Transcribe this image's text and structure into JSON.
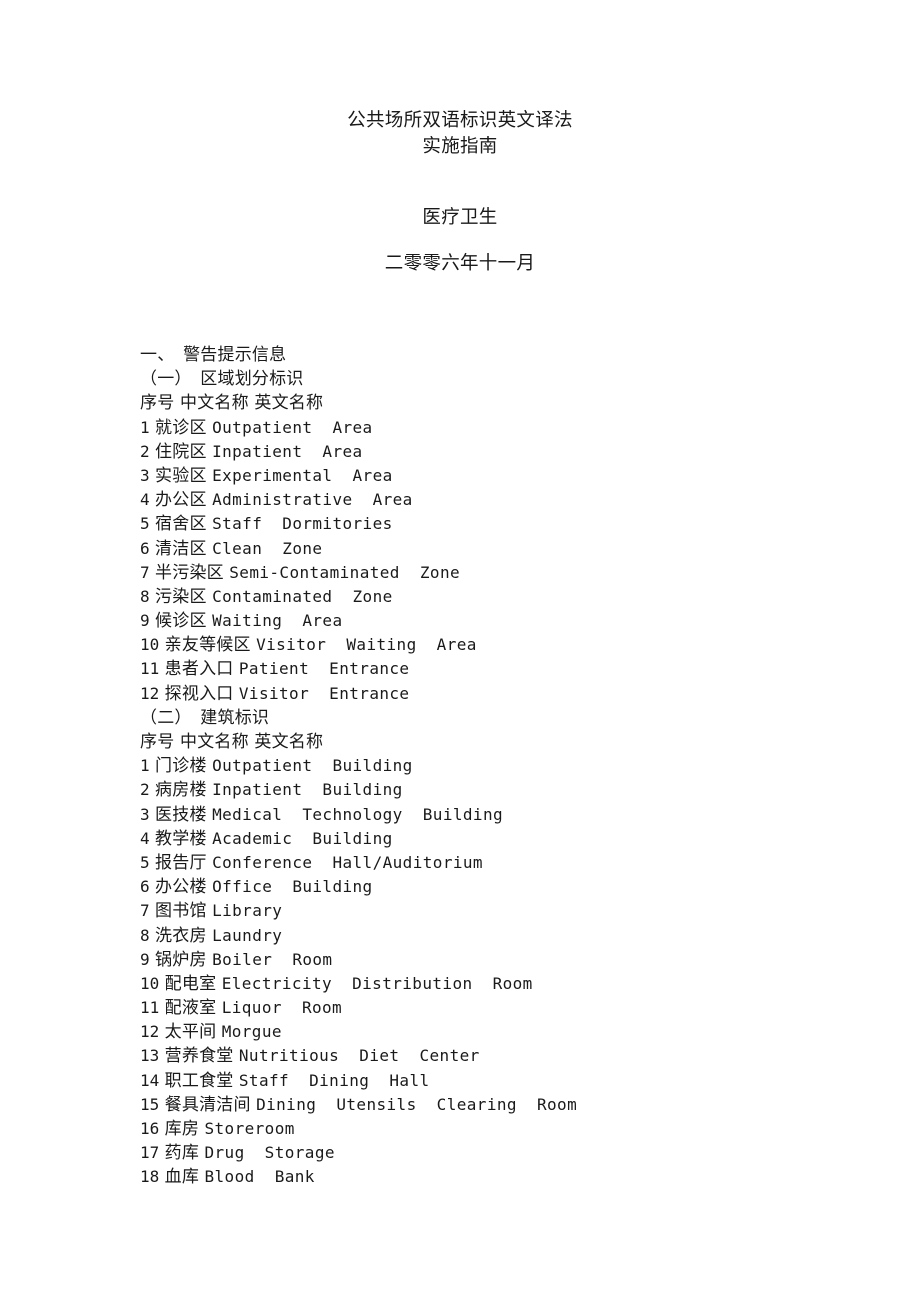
{
  "document": {
    "title_lines": [
      "公共场所双语标识英文译法",
      "实施指南"
    ],
    "subject": "医疗卫生",
    "date": "二零零六年十一月"
  },
  "body": {
    "chapter": "一、　警告提示信息",
    "sections": [
      {
        "heading": "（一）　区域划分标识",
        "columns": "序号 中文名称 英文名称",
        "columns_parts": {
          "no": "序号",
          "cn": "中文名称",
          "en": "英文名称"
        },
        "rows": [
          {
            "no": "1",
            "cn": "就诊区",
            "en": "Outpatient  Area"
          },
          {
            "no": "2",
            "cn": "住院区",
            "en": "Inpatient  Area"
          },
          {
            "no": "3",
            "cn": "实验区",
            "en": "Experimental  Area"
          },
          {
            "no": "4",
            "cn": "办公区",
            "en": "Administrative  Area"
          },
          {
            "no": "5",
            "cn": "宿舍区",
            "en": "Staff  Dormitories"
          },
          {
            "no": "6",
            "cn": "清洁区",
            "en": "Clean  Zone"
          },
          {
            "no": "7",
            "cn": "半污染区",
            "en": "Semi-Contaminated  Zone"
          },
          {
            "no": "8",
            "cn": "污染区",
            "en": "Contaminated  Zone"
          },
          {
            "no": "9",
            "cn": "候诊区",
            "en": "Waiting  Area"
          },
          {
            "no": "10",
            "cn": "亲友等候区",
            "en": "Visitor  Waiting  Area"
          },
          {
            "no": "11",
            "cn": "患者入口",
            "en": "Patient  Entrance"
          },
          {
            "no": "12",
            "cn": "探视入口",
            "en": "Visitor  Entrance"
          }
        ]
      },
      {
        "heading": "（二）　建筑标识",
        "columns": "序号 中文名称 英文名称",
        "columns_parts": {
          "no": "序号",
          "cn": "中文名称",
          "en": "英文名称"
        },
        "rows": [
          {
            "no": "1",
            "cn": "门诊楼",
            "en": "Outpatient  Building"
          },
          {
            "no": "2",
            "cn": "病房楼",
            "en": "Inpatient  Building"
          },
          {
            "no": "3",
            "cn": "医技楼",
            "en": "Medical  Technology  Building"
          },
          {
            "no": "4",
            "cn": "教学楼",
            "en": "Academic  Building"
          },
          {
            "no": "5",
            "cn": "报告厅",
            "en": "Conference  Hall/Auditorium"
          },
          {
            "no": "6",
            "cn": "办公楼",
            "en": "Office  Building"
          },
          {
            "no": "7",
            "cn": "图书馆",
            "en": "Library"
          },
          {
            "no": "8",
            "cn": "洗衣房",
            "en": "Laundry"
          },
          {
            "no": "9",
            "cn": "锅炉房",
            "en": "Boiler  Room"
          },
          {
            "no": "10",
            "cn": "配电室",
            "en": "Electricity  Distribution  Room"
          },
          {
            "no": "11",
            "cn": "配液室",
            "en": "Liquor  Room"
          },
          {
            "no": "12",
            "cn": "太平间",
            "en": "Morgue"
          },
          {
            "no": "13",
            "cn": "营养食堂",
            "en": "Nutritious  Diet  Center"
          },
          {
            "no": "14",
            "cn": "职工食堂",
            "en": "Staff  Dining  Hall"
          },
          {
            "no": "15",
            "cn": "餐具清洁间",
            "en": "Dining  Utensils  Clearing  Room"
          },
          {
            "no": "16",
            "cn": "库房",
            "en": "Storeroom"
          },
          {
            "no": "17",
            "cn": "药库",
            "en": "Drug  Storage"
          },
          {
            "no": "18",
            "cn": "血库",
            "en": "Blood  Bank"
          }
        ]
      }
    ]
  }
}
